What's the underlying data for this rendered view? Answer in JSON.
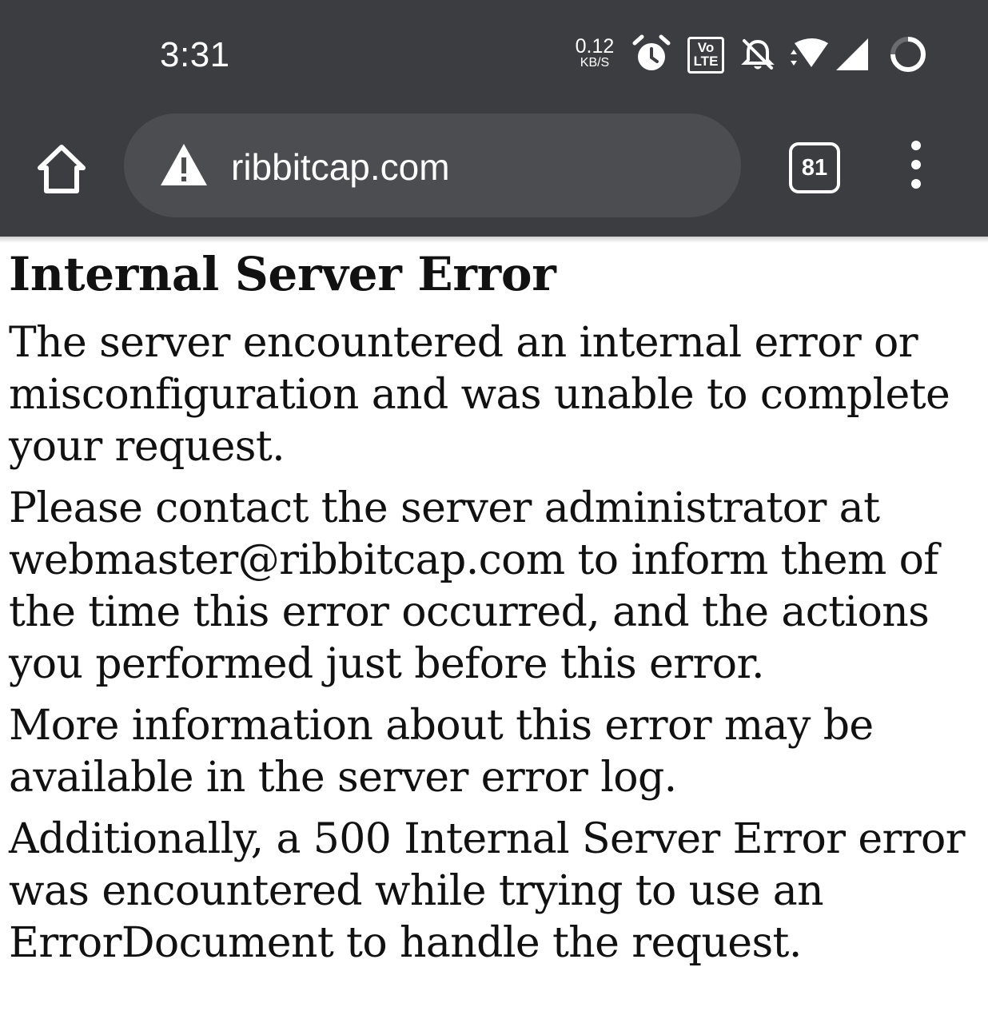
{
  "status_bar": {
    "time": "3:31",
    "net_speed_value": "0.12",
    "net_speed_unit": "KB/S",
    "volte_label_top": "Vo",
    "volte_label_bottom": "LTE",
    "icons": [
      "alarm-icon",
      "volte-icon",
      "bell-off-icon",
      "wifi-icon",
      "signal-icon",
      "battery-ring-icon"
    ]
  },
  "toolbar": {
    "home_icon": "home-icon",
    "security_icon": "warning-triangle-icon",
    "url": "ribbitcap.com",
    "tab_count": "81",
    "menu_icon": "kebab-menu-icon"
  },
  "colors": {
    "toolbar_bg": "#3c3d40",
    "omnibox_bg": "#4c4d51",
    "page_bg": "#ffffff",
    "text": "#111111"
  },
  "page": {
    "heading": "Internal Server Error",
    "paragraphs": [
      "The server encountered an internal error or misconfiguration and was unable to complete your request.",
      "Please contact the server administrator at webmaster@ribbitcap.com to inform them of the time this error occurred, and the actions you performed just before this error.",
      "More information about this error may be available in the server error log.",
      "Additionally, a 500 Internal Server Error error was encountered while trying to use an ErrorDocument to handle the request."
    ]
  }
}
